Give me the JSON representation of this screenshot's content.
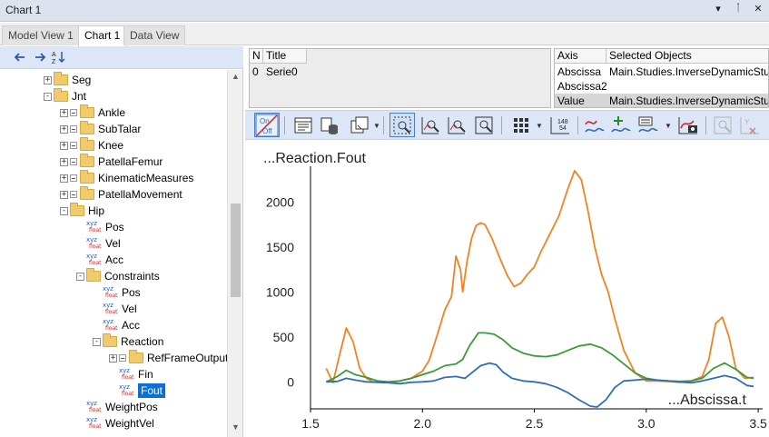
{
  "window": {
    "title": "Chart 1",
    "pin_label": "▾",
    "dock_label": "ᛙ",
    "close_label": "✕"
  },
  "tabs": [
    {
      "label": "Model View 1",
      "active": false
    },
    {
      "label": "Chart 1",
      "active": true
    },
    {
      "label": "Data View",
      "active": false
    }
  ],
  "left_toolbar": {
    "back_icon": "arrow-left-icon",
    "forward_icon": "arrow-right-icon",
    "sort_icon": "sort-az-icon"
  },
  "tree": [
    {
      "label": "Seg",
      "kind": "folder"
    },
    {
      "label": "Jnt",
      "kind": "folder"
    },
    {
      "label": "Ankle",
      "kind": "folder"
    },
    {
      "label": "SubTalar",
      "kind": "folder"
    },
    {
      "label": "Knee",
      "kind": "folder"
    },
    {
      "label": "PatellaFemur",
      "kind": "folder"
    },
    {
      "label": "KinematicMeasures",
      "kind": "folder"
    },
    {
      "label": "PatellaMovement",
      "kind": "folder"
    },
    {
      "label": "Hip",
      "kind": "folder"
    },
    {
      "label": "Pos",
      "kind": "float"
    },
    {
      "label": "Vel",
      "kind": "float"
    },
    {
      "label": "Acc",
      "kind": "float"
    },
    {
      "label": "Constraints",
      "kind": "folder"
    },
    {
      "label": "Pos",
      "kind": "float"
    },
    {
      "label": "Vel",
      "kind": "float"
    },
    {
      "label": "Acc",
      "kind": "float"
    },
    {
      "label": "Reaction",
      "kind": "folder"
    },
    {
      "label": "RefFrameOutput",
      "kind": "folder"
    },
    {
      "label": "Fin",
      "kind": "float"
    },
    {
      "label": "Fout",
      "kind": "float",
      "selected": true
    },
    {
      "label": "WeightPos",
      "kind": "float"
    },
    {
      "label": "WeightVel",
      "kind": "float"
    }
  ],
  "float_icon": {
    "top": "xyz",
    "bottom": "float"
  },
  "series_table": {
    "headers": [
      "N",
      "Title"
    ],
    "rows": [
      {
        "n": "0",
        "title": "Serie0"
      }
    ]
  },
  "axis_table": {
    "headers": [
      "Axis",
      "Selected Objects"
    ],
    "rows": [
      {
        "axis": "Abscissa",
        "object": "Main.Studies.InverseDynamicStudy.Output.Abscissa.t"
      },
      {
        "axis": "Abscissa2",
        "object": ""
      },
      {
        "axis": "Value",
        "object": "Main.Studies.InverseDynamicStudy.Output.BodyModel.Left.Leg.Jnt.Hip.Constraints.",
        "selected": true
      }
    ]
  },
  "chart_toolbar": {
    "on_off_top": "On",
    "on_off_bottom": "Off",
    "data_icon_top": "148",
    "data_icon_bottom": "54"
  },
  "chart_data": {
    "type": "line",
    "title": "...Reaction.Fout",
    "xlabel": "...Abscissa.t",
    "ylabel": "",
    "xlim": [
      1.5,
      3.52
    ],
    "ylim": [
      -300,
      2400
    ],
    "xticks": [
      "1.5",
      "2.0",
      "2.5",
      "3.0",
      "3.5"
    ],
    "xtick_values": [
      1.5,
      2.0,
      2.5,
      3.0,
      3.5
    ],
    "yticks": [
      "0",
      "500",
      "1000",
      "1500",
      "2000"
    ],
    "ytick_values": [
      0,
      500,
      1000,
      1500,
      2000
    ],
    "grid": false,
    "series": [
      {
        "color": "#f28322",
        "x": [
          1.57,
          1.6,
          1.63,
          1.66,
          1.69,
          1.72,
          1.75,
          1.78,
          1.82,
          1.86,
          1.9,
          1.95,
          2.0,
          2.03,
          2.07,
          2.1,
          2.13,
          2.15,
          2.17,
          2.18,
          2.2,
          2.22,
          2.24,
          2.26,
          2.28,
          2.31,
          2.35,
          2.38,
          2.41,
          2.44,
          2.47,
          2.5,
          2.53,
          2.57,
          2.61,
          2.65,
          2.68,
          2.71,
          2.74,
          2.77,
          2.8,
          2.83,
          2.86,
          2.9,
          2.95,
          3.0,
          3.05,
          3.1,
          3.15,
          3.2,
          3.25,
          3.28,
          3.31,
          3.34,
          3.37,
          3.4,
          3.44,
          3.48
        ],
        "values": [
          150,
          -10,
          300,
          600,
          450,
          150,
          40,
          0,
          -5,
          0,
          10,
          40,
          120,
          240,
          550,
          800,
          950,
          1400,
          1250,
          1000,
          1350,
          1600,
          1740,
          1770,
          1750,
          1600,
          1350,
          1180,
          1060,
          1100,
          1200,
          1280,
          1450,
          1650,
          1850,
          2150,
          2350,
          2250,
          1900,
          1500,
          1200,
          1000,
          700,
          350,
          100,
          10,
          10,
          5,
          -5,
          10,
          60,
          250,
          650,
          720,
          500,
          150,
          40,
          50
        ]
      },
      {
        "color": "#3a9a3a",
        "x": [
          1.57,
          1.62,
          1.66,
          1.7,
          1.75,
          1.8,
          1.85,
          1.9,
          1.95,
          2.0,
          2.05,
          2.1,
          2.15,
          2.18,
          2.21,
          2.25,
          2.28,
          2.32,
          2.36,
          2.4,
          2.45,
          2.5,
          2.55,
          2.6,
          2.65,
          2.7,
          2.75,
          2.8,
          2.85,
          2.9,
          2.95,
          3.0,
          3.05,
          3.1,
          3.15,
          3.2,
          3.25,
          3.3,
          3.35,
          3.4,
          3.45,
          3.48
        ],
        "values": [
          0,
          60,
          130,
          80,
          50,
          10,
          0,
          10,
          40,
          80,
          120,
          180,
          200,
          250,
          400,
          545,
          545,
          530,
          470,
          380,
          320,
          290,
          280,
          300,
          350,
          400,
          420,
          380,
          300,
          200,
          100,
          40,
          20,
          10,
          5,
          10,
          40,
          150,
          210,
          140,
          50,
          40
        ]
      },
      {
        "color": "#2f6fb5",
        "x": [
          1.57,
          1.62,
          1.66,
          1.7,
          1.75,
          1.8,
          1.85,
          1.9,
          1.95,
          2.0,
          2.05,
          2.1,
          2.15,
          2.19,
          2.22,
          2.26,
          2.3,
          2.33,
          2.36,
          2.4,
          2.45,
          2.5,
          2.55,
          2.6,
          2.65,
          2.7,
          2.75,
          2.78,
          2.82,
          2.86,
          2.9,
          2.95,
          3.0,
          3.05,
          3.1,
          3.15,
          3.2,
          3.25,
          3.3,
          3.35,
          3.4,
          3.45,
          3.48
        ],
        "values": [
          0,
          5,
          40,
          20,
          0,
          -5,
          -10,
          -20,
          -5,
          0,
          10,
          50,
          60,
          40,
          100,
          180,
          210,
          190,
          110,
          40,
          10,
          0,
          -20,
          -60,
          -120,
          -200,
          -270,
          -280,
          -200,
          -60,
          10,
          20,
          30,
          20,
          10,
          0,
          -10,
          10,
          40,
          70,
          40,
          -40,
          -50
        ]
      }
    ]
  }
}
